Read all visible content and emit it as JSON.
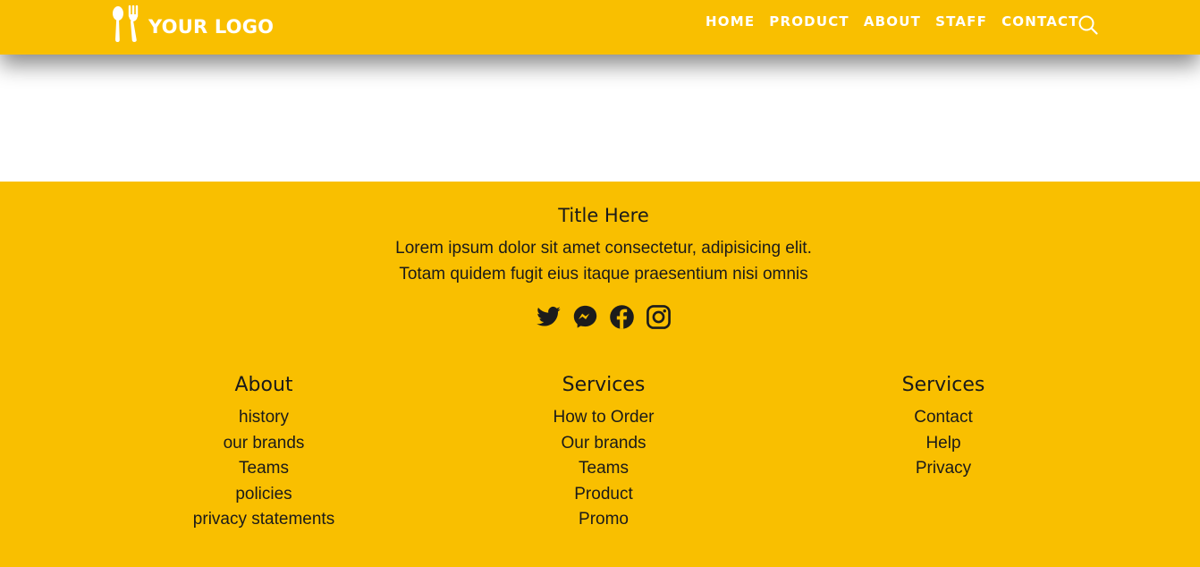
{
  "navbar": {
    "logo_text": "YOUR LOGO",
    "logo_icon": "cutlery-icon",
    "links": [
      "HOME",
      "PRODUCT",
      "ABOUT",
      "STAFF",
      "CONTACT"
    ],
    "search_icon": "search-icon"
  },
  "footer": {
    "title": "Title Here",
    "description_line1": "Lorem ipsum dolor sit amet consectetur, adipisicing elit.",
    "description_line2": "Totam quidem fugit eius itaque praesentium nisi omnis",
    "social": [
      "twitter-icon",
      "messenger-icon",
      "facebook-icon",
      "instagram-icon"
    ],
    "columns": [
      {
        "heading": "About",
        "items": [
          "history",
          "our brands",
          "Teams",
          "policies",
          "privacy statements"
        ]
      },
      {
        "heading": "Services",
        "items": [
          "How to Order",
          "Our brands",
          "Teams",
          "Product",
          "Promo"
        ]
      },
      {
        "heading": "Services",
        "items": [
          "Contact",
          "Help",
          "Privacy"
        ]
      }
    ]
  },
  "colors": {
    "brand_yellow": "#f9bf00",
    "nav_text": "#ffffff",
    "footer_text": "#1a1a1a"
  }
}
